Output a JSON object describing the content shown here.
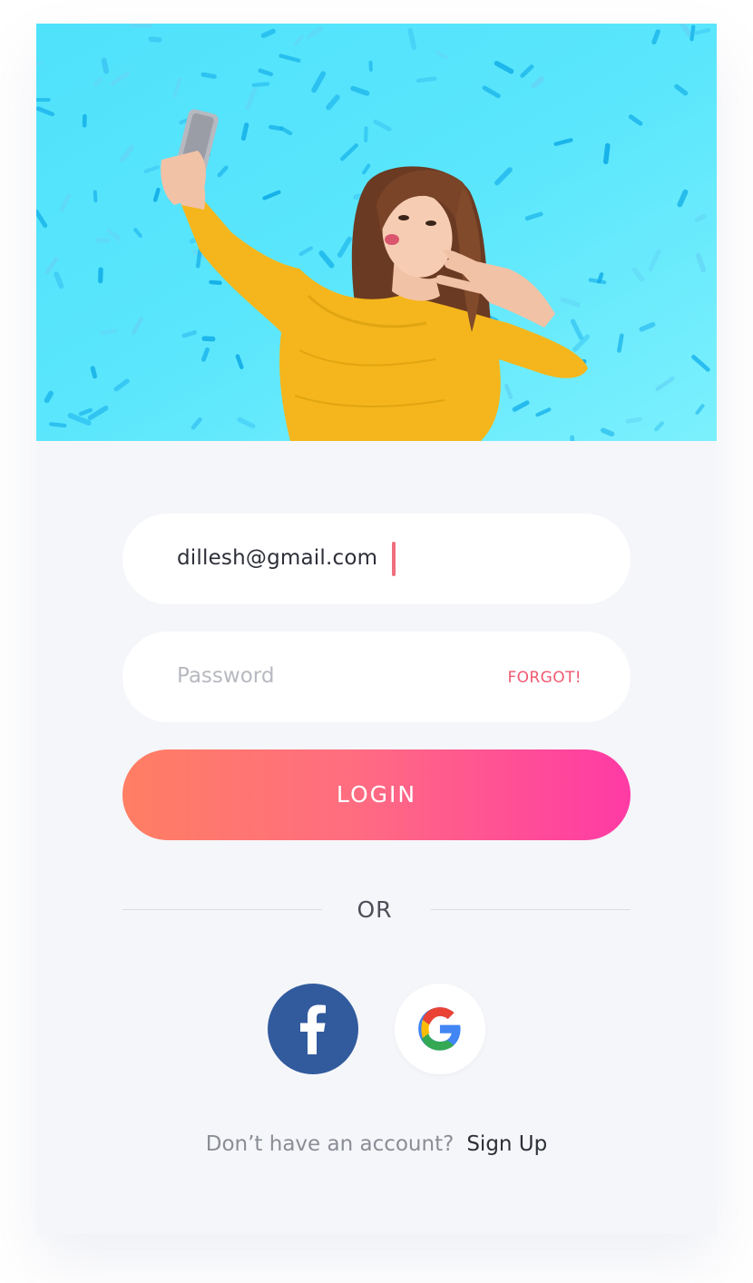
{
  "hero": {
    "background_color": "#5ae6fc",
    "image": "woman-taking-selfie-in-yellow-sweater"
  },
  "login_form": {
    "email_value": "dillesh@gmail.com",
    "password_placeholder": "Password",
    "forgot_label": "FORGOT!",
    "login_label": "LOGIN",
    "divider_text": "OR"
  },
  "social": {
    "facebook_icon": "facebook-icon",
    "google_icon": "google-icon",
    "facebook_color": "#325b9e"
  },
  "footer": {
    "question": "Don’t have an account?",
    "signup_label": "Sign Up"
  },
  "colors": {
    "accent_gradient_start": "#ff7e63",
    "accent_gradient_end": "#ff3aa5",
    "forgot": "#f05a72",
    "caret": "#ef6f7f"
  }
}
